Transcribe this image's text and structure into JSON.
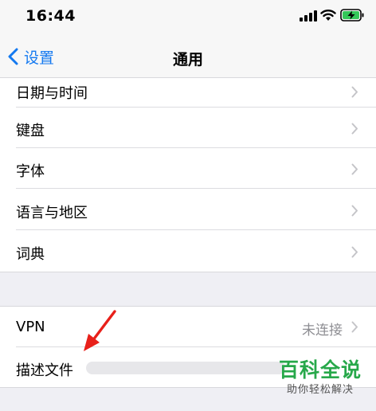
{
  "status_bar": {
    "time": "16:44"
  },
  "nav": {
    "back_label": "设置",
    "title": "通用"
  },
  "settings": {
    "group_top": [
      {
        "label": "日期与时间"
      },
      {
        "label": "键盘"
      },
      {
        "label": "字体"
      },
      {
        "label": "语言与地区"
      },
      {
        "label": "词典"
      }
    ],
    "vpn": {
      "label": "VPN",
      "value": "未连接"
    },
    "profile": {
      "label": "描述文件"
    }
  },
  "watermark": {
    "title": "百科全说",
    "subtitle": "助你轻松解决"
  },
  "colors": {
    "accent_blue": "#1479f0",
    "annotation_red": "#e8201a",
    "watermark_green": "#27a84a",
    "battery_green": "#34c759"
  }
}
